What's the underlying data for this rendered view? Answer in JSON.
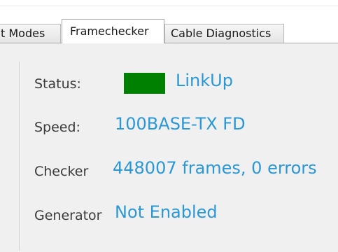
{
  "tabs": [
    {
      "label": "t Modes",
      "selected": false
    },
    {
      "label": "Framechecker",
      "selected": true
    },
    {
      "label": "Cable Diagnostics",
      "selected": false
    }
  ],
  "status": {
    "label": "Status:",
    "indicator_color": "#008000",
    "value": "LinkUp"
  },
  "speed": {
    "label": "Speed:",
    "value": "100BASE-TX FD"
  },
  "checker": {
    "label": "Checker",
    "value": "448007 frames, 0 errors"
  },
  "generator": {
    "label": "Generator",
    "value": "Not Enabled"
  },
  "colors": {
    "value_text": "#2b98d6",
    "label_text": "#3a3a3a",
    "panel_background": "#f0f0f0"
  }
}
